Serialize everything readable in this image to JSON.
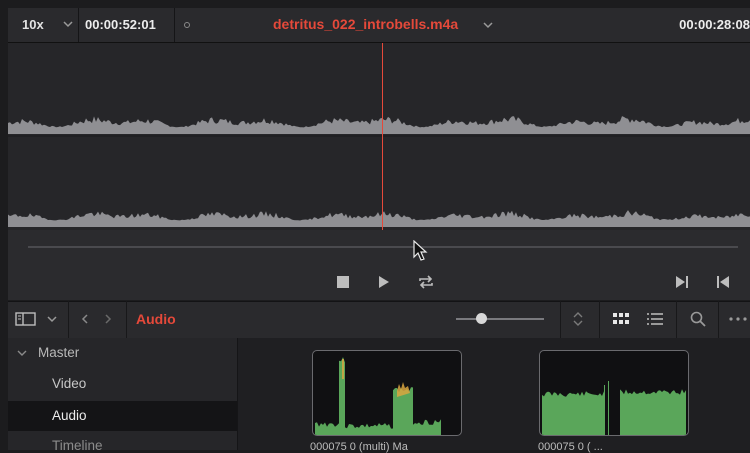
{
  "viewer": {
    "zoom": "10x",
    "timecode_current": "00:00:52:01",
    "clip_title": "detritus_022_introbells.m4a",
    "timecode_duration": "00:00:28:08"
  },
  "transport": {
    "icons": [
      "stop-icon",
      "play-icon",
      "loop-icon",
      "next-frame-icon",
      "prev-frame-icon"
    ]
  },
  "browser": {
    "bin_title": "Audio",
    "icons": [
      "panel-toggle-icon",
      "chevron-down-icon",
      "back-icon",
      "forward-icon",
      "sort-icon",
      "grid-view-icon",
      "list-view-icon",
      "search-icon",
      "more-icon"
    ]
  },
  "sidebar": {
    "master_label": "Master",
    "items": [
      {
        "label": "Video"
      },
      {
        "label": "Audio"
      },
      {
        "label": "Timeline"
      }
    ]
  },
  "pool": {
    "clips": [
      {
        "label": "000075 0 (multi) Ma"
      },
      {
        "label": "000075 0 ( ..."
      }
    ]
  },
  "colors": {
    "accent": "#e5493a",
    "waveform": "#8f8f93",
    "thumb_wave": "#5aa65a",
    "thumb_peak": "#e0b040"
  }
}
